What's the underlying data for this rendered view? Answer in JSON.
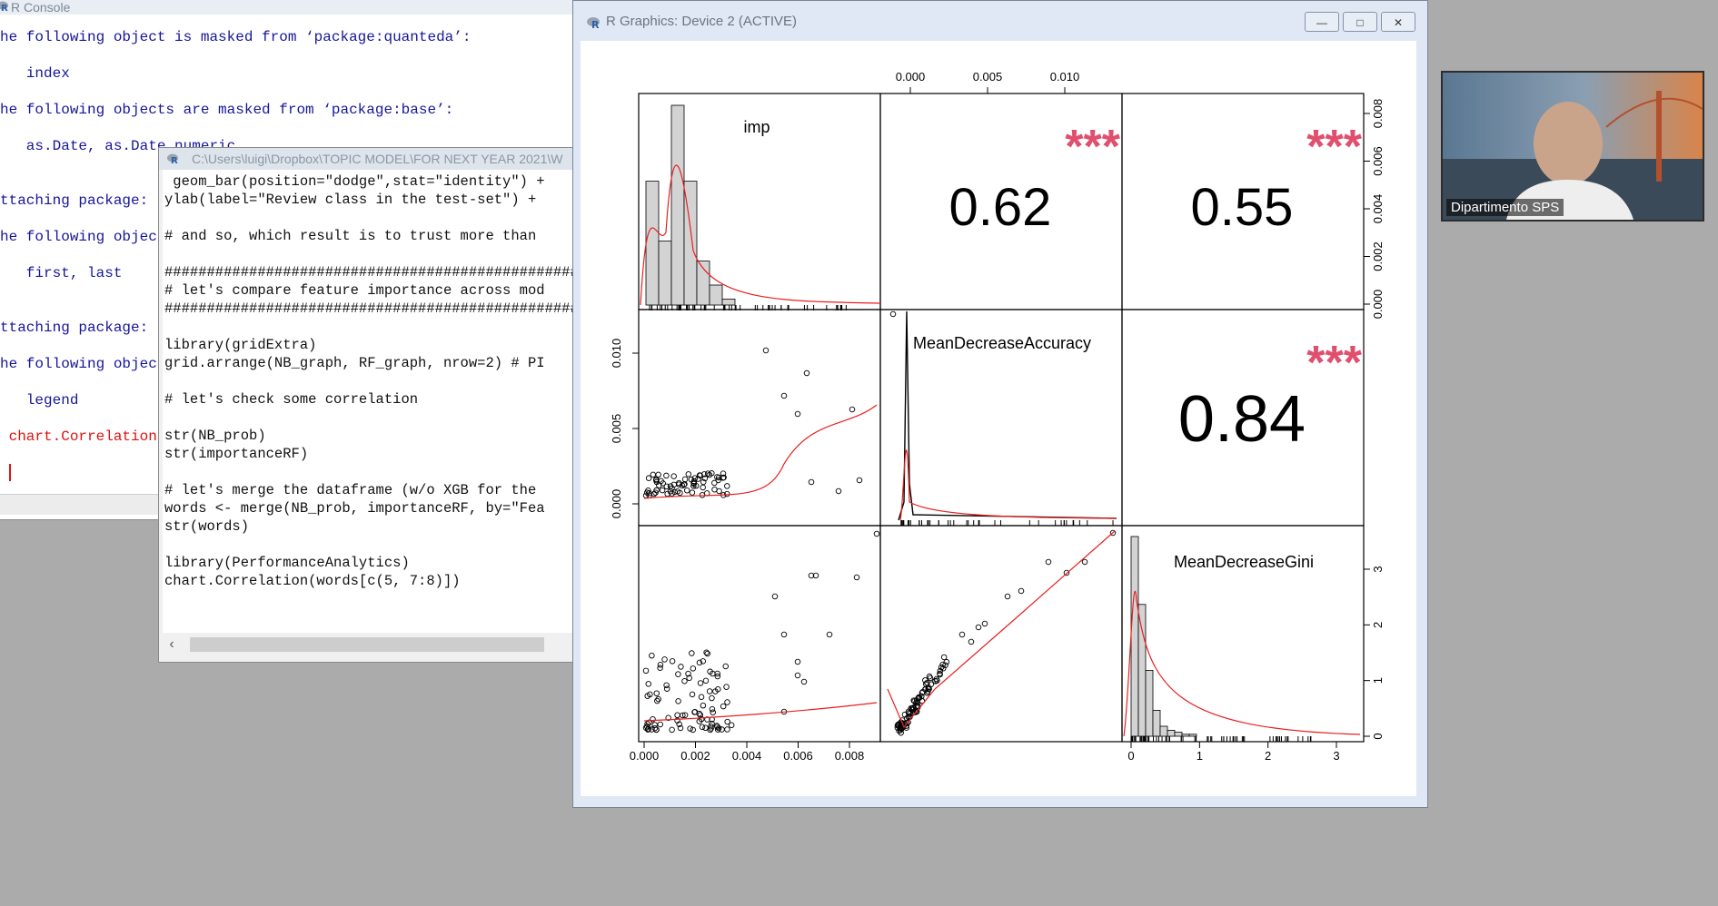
{
  "console": {
    "title": "R Console",
    "lines": [
      {
        "text": "he following object is masked from ‘package:quanteda’:",
        "color": "blue"
      },
      {
        "text": "   index",
        "color": "blue"
      },
      {
        "text": "he following objects are masked from ‘package:base’:",
        "color": "blue"
      },
      {
        "text": "   as.Date, as.Date.numeric",
        "color": "blue"
      },
      {
        "text": "ttaching package:",
        "color": "blue"
      },
      {
        "text": "he following object",
        "color": "blue"
      },
      {
        "text": "   first, last",
        "color": "blue"
      },
      {
        "text": "ttaching package:",
        "color": "blue"
      },
      {
        "text": "he following object",
        "color": "blue"
      },
      {
        "text": "   legend",
        "color": "blue"
      },
      {
        "text": " chart.Correlation",
        "color": "red"
      }
    ]
  },
  "editor": {
    "title": "C:\\Users\\luigi\\Dropbox\\TOPIC MODEL\\FOR NEXT YEAR 2021\\W",
    "lines": [
      " geom_bar(position=\"dodge\",stat=\"identity\") +",
      "ylab(label=\"Review class in the test-set\") +",
      "",
      "# and so, which result is to trust more than",
      "",
      "##################################################",
      "# let's compare feature importance across mod",
      "##################################################",
      "",
      "library(gridExtra)",
      "grid.arrange(NB_graph, RF_graph, nrow=2) # PI",
      "",
      "# let's check some correlation",
      "",
      "str(NB_prob)",
      "str(importanceRF)",
      "",
      "# let's merge the dataframe (w/o XGB for the",
      "words <- merge(NB_prob, importanceRF, by=\"Fea",
      "str(words)",
      "",
      "library(PerformanceAnalytics)",
      "chart.Correlation(words[c(5, 7:8)])"
    ]
  },
  "device": {
    "title": "R Graphics: Device 2 (ACTIVE)",
    "minimize_label": "—",
    "maximize_label": "□",
    "close_label": "✕"
  },
  "webcam": {
    "name": "Dipartimento SPS"
  },
  "chart_data": {
    "type": "scatter",
    "variables": [
      "imp",
      "MeanDecreaseAccuracy",
      "MeanDecreaseGini"
    ],
    "correlations": [
      {
        "pair": [
          "imp",
          "MeanDecreaseAccuracy"
        ],
        "r": "0.62",
        "stars": "***"
      },
      {
        "pair": [
          "imp",
          "MeanDecreaseGini"
        ],
        "r": "0.55",
        "stars": "***"
      },
      {
        "pair": [
          "MeanDecreaseAccuracy",
          "MeanDecreaseGini"
        ],
        "r": "0.84",
        "stars": "***"
      }
    ],
    "ticks": {
      "top": [
        "0.000",
        "0.005",
        "0.010"
      ],
      "bottom_left": [
        "0.000",
        "0.002",
        "0.004",
        "0.006",
        "0.008"
      ],
      "bottom_right": [
        "0",
        "1",
        "2",
        "3"
      ],
      "left_middle": [
        "0.000",
        "0.005",
        "0.010"
      ],
      "right_top": [
        "0.000",
        "0.002",
        "0.004",
        "0.006",
        "0.008"
      ],
      "right_bottom": [
        "0",
        "1",
        "2",
        "3"
      ]
    },
    "histogram_imp": [
      0.62,
      0.32,
      1.0,
      0.62,
      0.22,
      0.1,
      0.03
    ],
    "histogram_gini": [
      1.0,
      0.66,
      0.33,
      0.13,
      0.05,
      0.03,
      0.02,
      0.01,
      0.01
    ],
    "star_color": "#e0506e",
    "smooth_color": "#e82020"
  }
}
